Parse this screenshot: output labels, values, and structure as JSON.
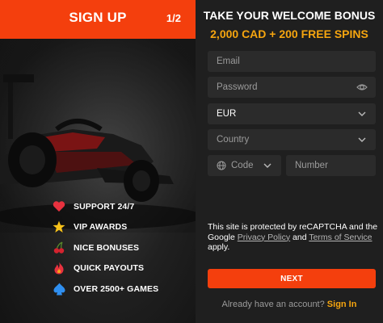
{
  "left": {
    "header": {
      "title": "SIGN UP",
      "step": "1/2"
    },
    "features": [
      {
        "icon": "heart-icon",
        "label": "SUPPORT 24/7"
      },
      {
        "icon": "star-icon",
        "label": "VIP AWARDS"
      },
      {
        "icon": "cherries-icon",
        "label": "NICE BONUSES"
      },
      {
        "icon": "flame-icon",
        "label": "QUICK PAYOUTS"
      },
      {
        "icon": "spade-icon",
        "label": "OVER 2500+ GAMES"
      }
    ]
  },
  "right": {
    "welcome_title": "TAKE YOUR WELCOME BONUS",
    "bonus_line": "2,000 CAD + 200 FREE SPINS",
    "form": {
      "email_placeholder": "Email",
      "password_placeholder": "Password",
      "currency_value": "EUR",
      "country_placeholder": "Country",
      "phone_code_placeholder": "Code",
      "phone_number_placeholder": "Number"
    },
    "recaptcha": {
      "text_before": "This site is protected by reCAPTCHA and the Google ",
      "privacy_link": "Privacy Policy",
      "and_text": " and ",
      "terms_link": "Terms of Service",
      "apply_text": " apply."
    },
    "next_button": "NEXT",
    "footer": {
      "question": "Already have an account?",
      "signin_link": "Sign In"
    }
  },
  "colors": {
    "accent": "#f43f0d",
    "gold": "#f6a50f",
    "panel": "#1f1f1f",
    "field": "#2b2b2b"
  }
}
